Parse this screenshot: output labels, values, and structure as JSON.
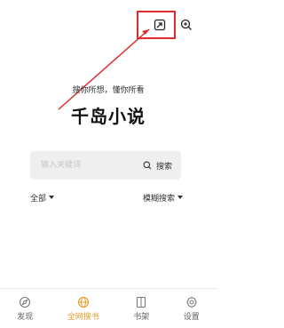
{
  "header": {
    "import_icon": "export-box-icon",
    "search_icon": "search-icon"
  },
  "hero": {
    "subtitle": "搜你所想，懂你所看",
    "title": "千岛小说"
  },
  "search": {
    "placeholder": "输入关键词",
    "button_label": "搜索"
  },
  "filters": {
    "left_label": "全部",
    "right_label": "模糊搜索"
  },
  "nav": {
    "items": [
      {
        "label": "发现",
        "icon": "compass-icon"
      },
      {
        "label": "全网搜书",
        "icon": "globe-icon"
      },
      {
        "label": "书架",
        "icon": "book-icon"
      },
      {
        "label": "设置",
        "icon": "gear-icon"
      }
    ],
    "active_color": "#e69b27"
  },
  "annotation_color": "#e12b2b"
}
